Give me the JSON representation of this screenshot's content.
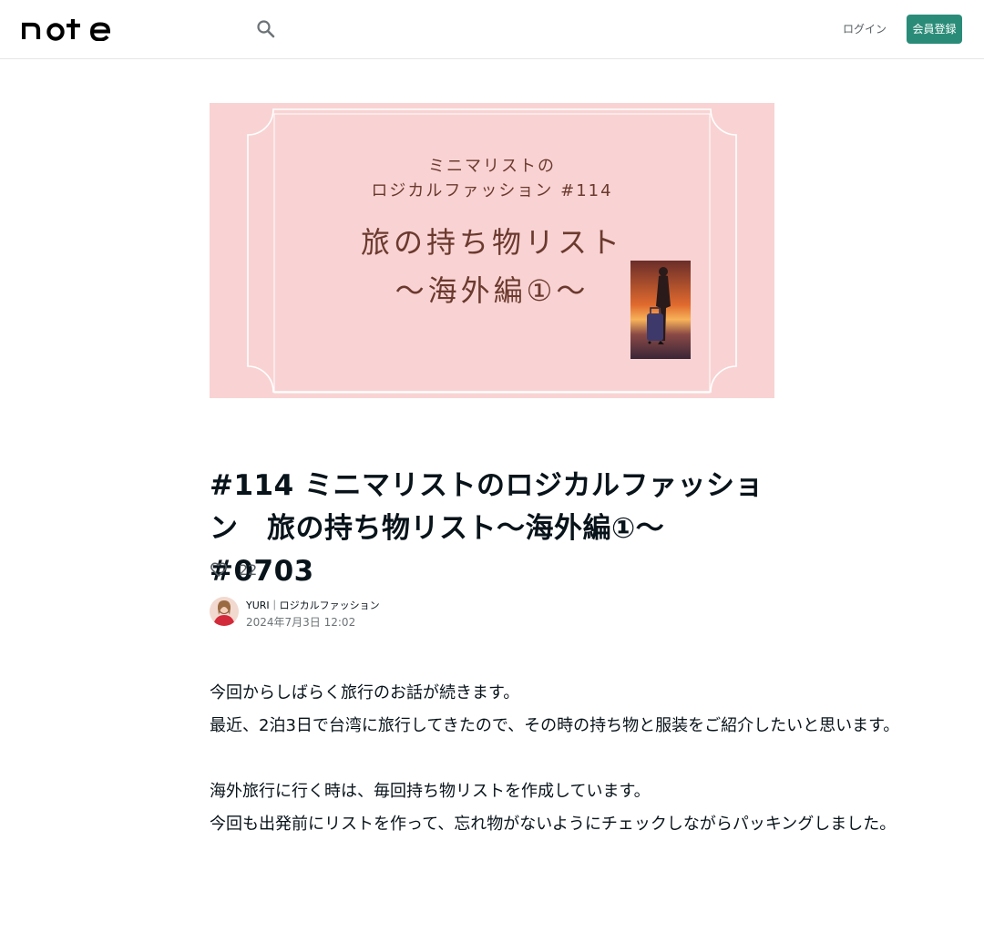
{
  "header": {
    "logo_text": "note",
    "login_label": "ログイン",
    "signup_label": "会員登録",
    "search_icon": "search-icon"
  },
  "eyecatch": {
    "sub_line1": "ミニマリストの",
    "sub_line2": "ロジカルファッション #114",
    "main_line1": "旅の持ち物リスト",
    "main_line2": "〜海外編①〜",
    "background_color": "#f9d3d3",
    "text_color": "#6b3a2e"
  },
  "article": {
    "title": "#114 ミニマリストのロジカルファッション　旅の持ち物リスト〜海外編①〜　#0703",
    "like_count": "22",
    "author": {
      "name": "YURI｜ロジカルファッション",
      "date": "2024年7月3日 12:02"
    },
    "body": [
      "今回からしばらく旅行のお話が続きます。",
      "最近、2泊3日で台湾に旅行してきたので、その時の持ち物と服装をご紹介したいと思います。",
      "",
      "海外旅行に行く時は、毎回持ち物リストを作成しています。",
      "今回も出発前にリストを作って、忘れ物がないようにチェックしながらパッキングしました。"
    ]
  },
  "colors": {
    "accent": "#2a8c78",
    "text": "#08131a",
    "muted": "#555d61"
  }
}
